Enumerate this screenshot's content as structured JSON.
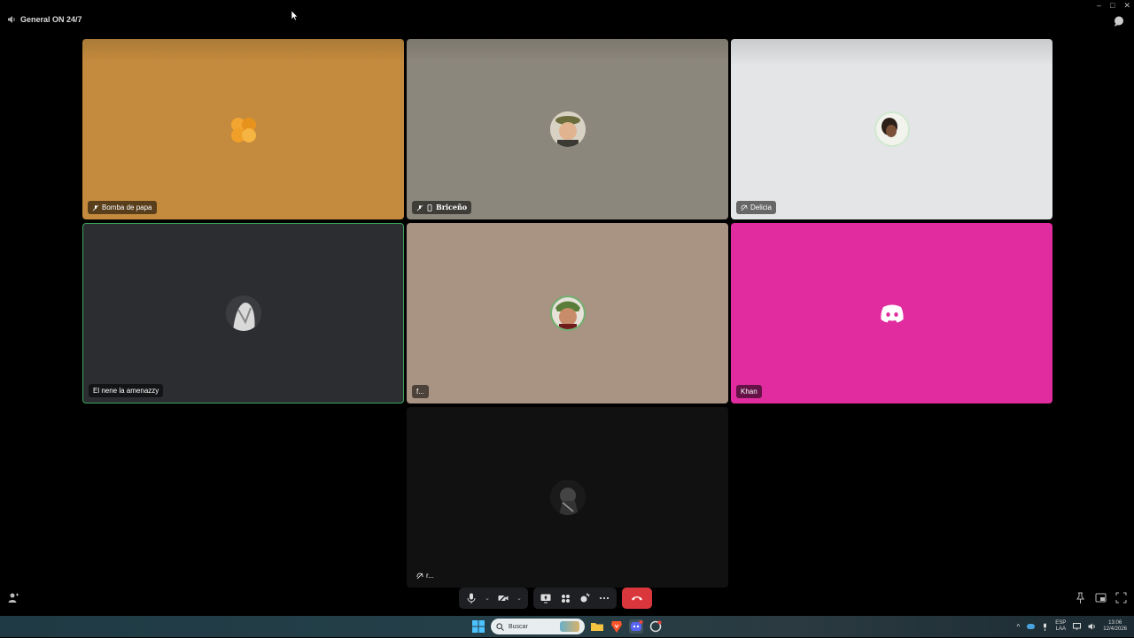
{
  "window": {
    "channel_name": "General ON 24/7",
    "controls": [
      "–",
      "□",
      "✕"
    ]
  },
  "participants": [
    {
      "name": "Bomba de papa",
      "status_icons": [
        "mic-muted-icon"
      ],
      "bg": "#c48a3d"
    },
    {
      "name": "Briceño",
      "status_icons": [
        "mic-muted-icon",
        "mobile-icon"
      ],
      "bg": "#8c877c"
    },
    {
      "name": "Delicia",
      "status_icons": [
        "deafened-icon"
      ],
      "bg": "#e4e5e6"
    },
    {
      "name": "El nene la amenazzy",
      "status_icons": [],
      "bg": "#2b2d31",
      "speaking": true
    },
    {
      "name": "f...",
      "status_icons": [],
      "bg": "#a99382"
    },
    {
      "name": "Khan",
      "status_icons": [],
      "bg": "#e02c9e"
    },
    {
      "name": "r...",
      "status_icons": [
        "deafened-icon"
      ],
      "bg": "#111111"
    }
  ],
  "toolbar": {
    "buttons": [
      "microphone-icon",
      "camera-off-icon",
      "screen-share-icon",
      "activities-icon",
      "soundboard-icon",
      "more-icon",
      "end-call-icon"
    ]
  },
  "taskbar": {
    "search_placeholder": "Buscar",
    "language_top": "ESP",
    "language_bottom": "LAA",
    "time": "13:06",
    "date": "12/4/2026"
  },
  "colors": {
    "accent_speaking": "#3ba55d",
    "end_call": "#da373c",
    "khan_bg": "#e02c9e"
  }
}
